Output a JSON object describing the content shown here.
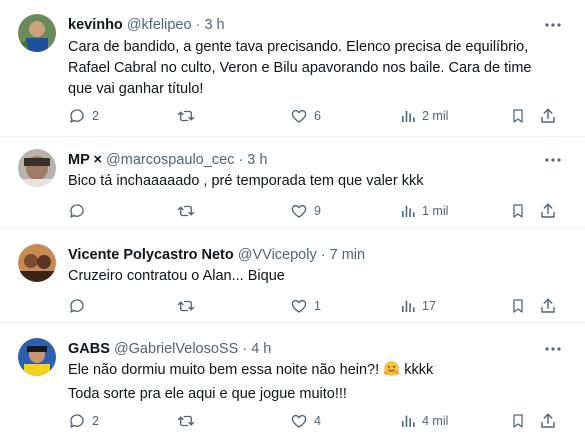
{
  "tweets": [
    {
      "name": "kevinho",
      "handle": "@kfelipeo",
      "separator": "·",
      "time": "3 h",
      "lines": [
        "Cara de bandido, a gente tava precisando. Elenco precisa de equilíbrio,",
        "Rafael Cabral no culto, Veron e Bilu apavorando nos baile. Cara de time",
        "que vai ganhar título!"
      ],
      "replies": "2",
      "retweets": "",
      "likes": "6",
      "views": "2 mil"
    },
    {
      "name": "MP ×",
      "handle": "@marcospaulo_cec",
      "separator": "·",
      "time": "3 h",
      "lines": [
        "Bico tá inchaaaaado , pré temporada tem que valer kkk"
      ],
      "replies": "",
      "retweets": "",
      "likes": "9",
      "views": "1 mil"
    },
    {
      "name": "Vicente Polycastro Neto",
      "handle": "@VVicepoly",
      "separator": "·",
      "time": "7 min",
      "lines": [
        "Cruzeiro contratou o Alan... Bique"
      ],
      "replies": "",
      "retweets": "",
      "likes": "1",
      "views": "17"
    },
    {
      "name": "GABS",
      "handle": "@GabrielVelosoSS",
      "separator": "·",
      "time": "4 h",
      "lines": [
        "Ele não dormiu muito bem essa noite não hein?!",
        "Toda sorte pra ele aqui e que jogue muito!!!"
      ],
      "line1_suffix": "kkkk",
      "replies": "2",
      "retweets": "",
      "likes": "4",
      "views": "4 mil"
    }
  ],
  "icons": {
    "more": "more-horizontal-icon",
    "reply": "reply-icon",
    "retweet": "retweet-icon",
    "like": "like-icon",
    "views": "views-icon",
    "bookmark": "bookmark-icon",
    "share": "share-icon",
    "emoji": "hugging-face-emoji"
  },
  "colors": {
    "text": "#0f1419",
    "secondary": "#536471",
    "divider": "#eff3f4"
  }
}
